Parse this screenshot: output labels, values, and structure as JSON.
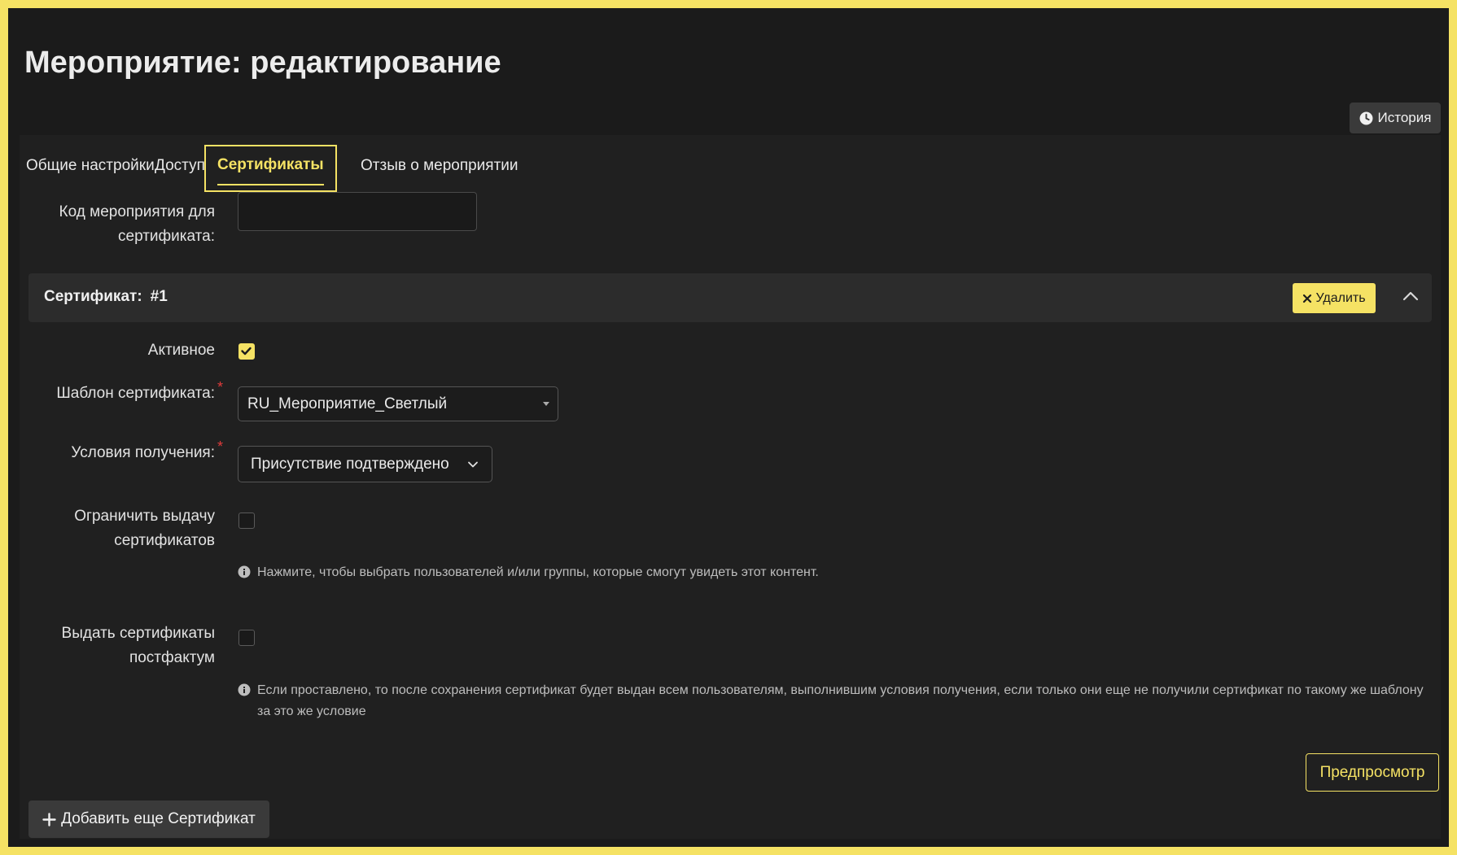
{
  "page": {
    "title": "Мероприятие: редактирование"
  },
  "header": {
    "history_label": "История"
  },
  "tabs": [
    {
      "label": "Общие настройки"
    },
    {
      "label": "Доступ"
    },
    {
      "label": "Сертификаты",
      "active": true
    },
    {
      "label": "Отзыв о мероприятии"
    }
  ],
  "form": {
    "event_code_label": "Код мероприятия для сертификата:",
    "event_code_value": "",
    "certificate": {
      "title": "Сертификат:",
      "number": "#1",
      "delete_label": "Удалить",
      "active_label": "Активное",
      "active_checked": true,
      "template_label": "Шаблон сертификата:",
      "template_value": "RU_Мероприятие_Светлый",
      "conditions_label": "Условия получения:",
      "conditions_value": "Присутствие подтверждено",
      "required_mark": "*",
      "limit_label": "Ограничить выдачу сертификатов",
      "limit_checked": false,
      "limit_hint": "Нажмите, чтобы выбрать пользователей и/или группы, которые смогут увидеть этот контент.",
      "postfactum_label": "Выдать сертификаты постфактум",
      "postfactum_checked": false,
      "postfactum_hint": "Если проставлено, то после сохранения сертификат будет выдан всем пользователям, выполнившим условия получения, если только они еще не получили сертификат по такому же шаблону за это же условие",
      "preview_label": "Предпросмотр"
    },
    "add_certificate_label": "Добавить еще Сертификат"
  },
  "colors": {
    "accent": "#f5e264",
    "background": "#1b1b1b",
    "panel": "#202020",
    "required": "#e03b3b"
  },
  "icons": [
    "clock-icon",
    "close-icon",
    "chevron-up-icon",
    "check-icon",
    "chevron-down-icon",
    "caret-down-icon",
    "info-icon",
    "plus-icon"
  ]
}
